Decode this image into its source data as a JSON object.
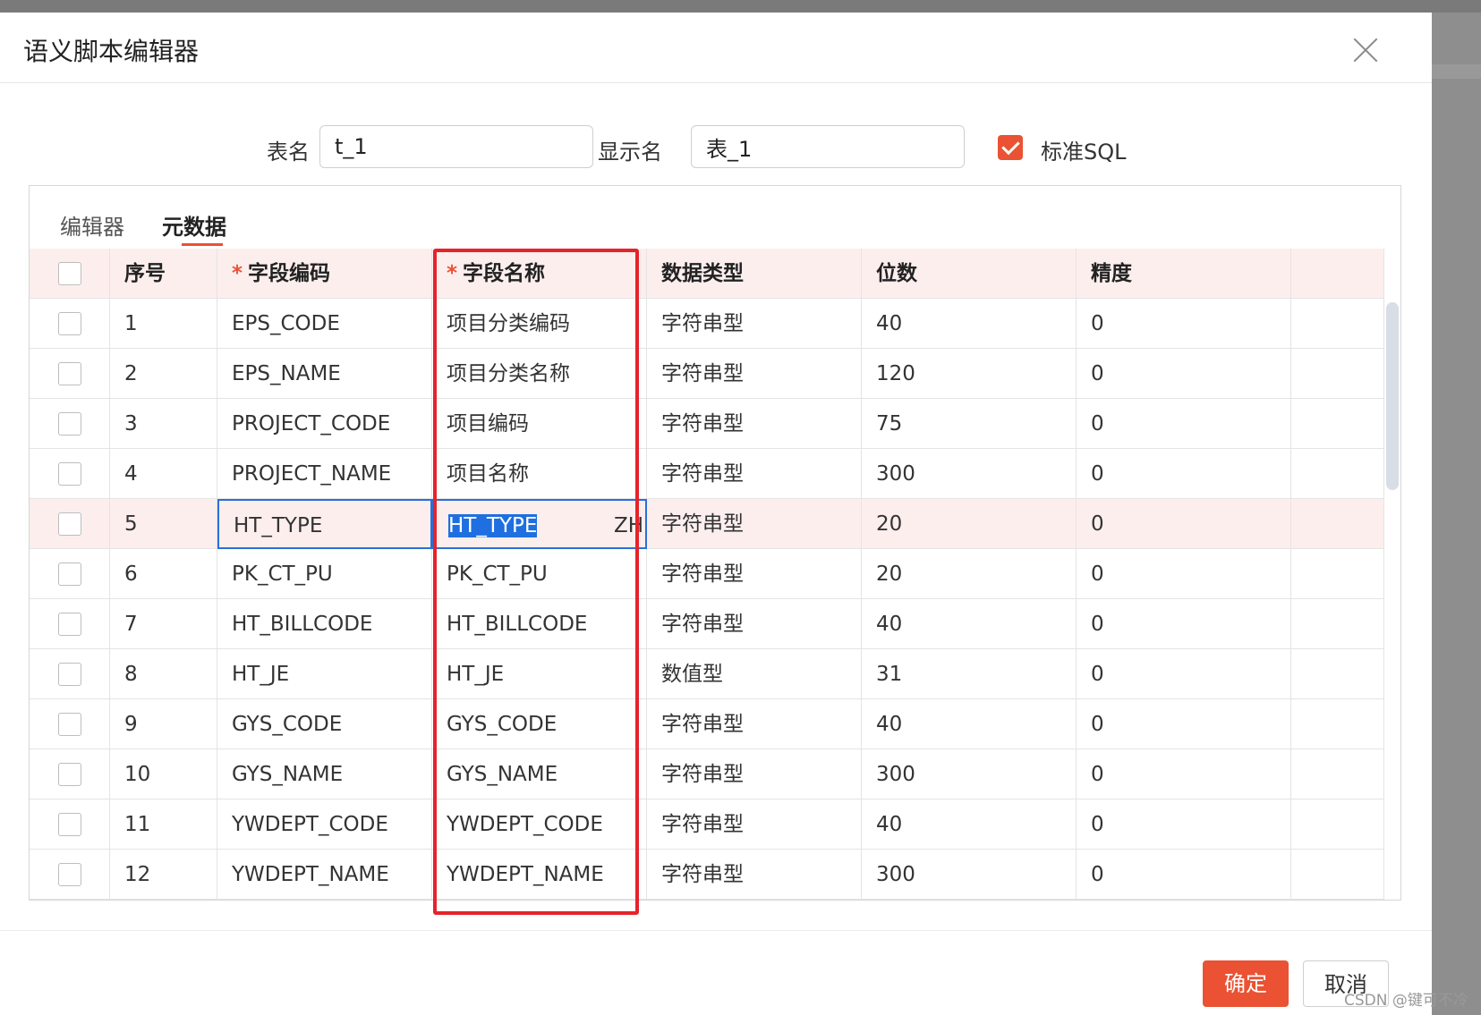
{
  "dialog": {
    "title": "语义脚本编辑器"
  },
  "form": {
    "table_name_label": "表名",
    "table_name_value": "t_1",
    "display_name_label": "显示名",
    "display_name_value": "表_1",
    "standard_sql_label": "标准SQL",
    "standard_sql_checked": true
  },
  "tabs": [
    {
      "label": "编辑器",
      "active": false
    },
    {
      "label": "元数据",
      "active": true
    }
  ],
  "table": {
    "headers": {
      "index": "序号",
      "field_code": "字段编码",
      "field_name": "字段名称",
      "data_type": "数据类型",
      "digits": "位数",
      "precision": "精度"
    },
    "rows": [
      {
        "index": "1",
        "field_code": "EPS_CODE",
        "field_name": "项目分类编码",
        "data_type": "字符串型",
        "digits": "40",
        "precision": "0"
      },
      {
        "index": "2",
        "field_code": "EPS_NAME",
        "field_name": "项目分类名称",
        "data_type": "字符串型",
        "digits": "120",
        "precision": "0"
      },
      {
        "index": "3",
        "field_code": "PROJECT_CODE",
        "field_name": "项目编码",
        "data_type": "字符串型",
        "digits": "75",
        "precision": "0"
      },
      {
        "index": "4",
        "field_code": "PROJECT_NAME",
        "field_name": "项目名称",
        "data_type": "字符串型",
        "digits": "300",
        "precision": "0"
      },
      {
        "index": "5",
        "field_code": "HT_TYPE",
        "field_name": "HT_TYPE",
        "field_name_suffix": "ZH",
        "data_type": "字符串型",
        "digits": "20",
        "precision": "0"
      },
      {
        "index": "6",
        "field_code": "PK_CT_PU",
        "field_name": "PK_CT_PU",
        "data_type": "字符串型",
        "digits": "20",
        "precision": "0"
      },
      {
        "index": "7",
        "field_code": "HT_BILLCODE",
        "field_name": "HT_BILLCODE",
        "data_type": "字符串型",
        "digits": "40",
        "precision": "0"
      },
      {
        "index": "8",
        "field_code": "HT_JE",
        "field_name": "HT_JE",
        "data_type": "数值型",
        "digits": "31",
        "precision": "0"
      },
      {
        "index": "9",
        "field_code": "GYS_CODE",
        "field_name": "GYS_CODE",
        "data_type": "字符串型",
        "digits": "40",
        "precision": "0"
      },
      {
        "index": "10",
        "field_code": "GYS_NAME",
        "field_name": "GYS_NAME",
        "data_type": "字符串型",
        "digits": "300",
        "precision": "0"
      },
      {
        "index": "11",
        "field_code": "YWDEPT_CODE",
        "field_name": "YWDEPT_CODE",
        "data_type": "字符串型",
        "digits": "40",
        "precision": "0"
      },
      {
        "index": "12",
        "field_code": "YWDEPT_NAME",
        "field_name": "YWDEPT_NAME",
        "data_type": "字符串型",
        "digits": "300",
        "precision": "0"
      }
    ]
  },
  "buttons": {
    "ok": "确定",
    "cancel": "取消"
  },
  "watermark": "CSDN @键可不冷",
  "colors": {
    "accent": "#ea5233",
    "header_bg": "#fdeeee",
    "highlight_border": "#e5232b",
    "edit_border": "#2a6fd6"
  }
}
